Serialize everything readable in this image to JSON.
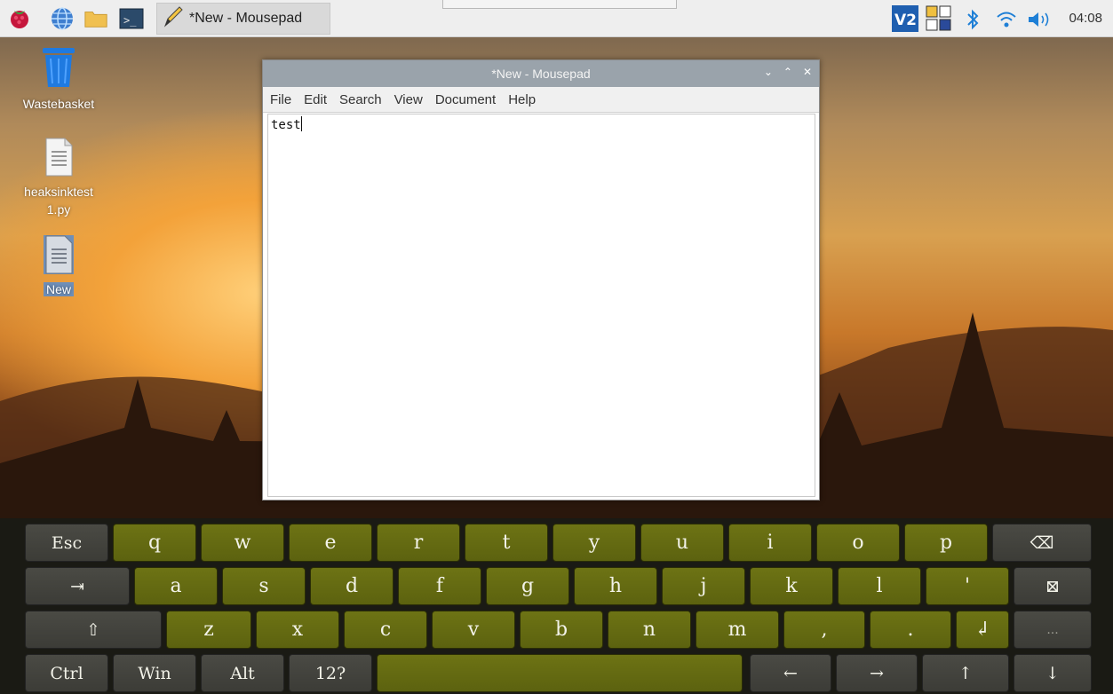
{
  "taskbar": {
    "task_title": "*New - Mousepad",
    "clock": "04:08",
    "icons": [
      "raspberry-menu-icon",
      "browser-globe-icon",
      "file-manager-icon",
      "terminal-icon",
      "text-editor-icon",
      "vnc-icon",
      "keyboard-layout-icon",
      "bluetooth-icon",
      "wifi-icon",
      "volume-icon"
    ]
  },
  "desktop": {
    "items": [
      {
        "label": "Wastebasket",
        "icon": "trash-icon"
      },
      {
        "label": "heaksinktest1.py",
        "icon": "file-icon"
      },
      {
        "label": "New",
        "icon": "file-icon"
      }
    ]
  },
  "window": {
    "title": "*New - Mousepad",
    "menu": [
      "File",
      "Edit",
      "Search",
      "View",
      "Document",
      "Help"
    ],
    "content": "test"
  },
  "keyboard": {
    "row1": [
      "Esc",
      "q",
      "w",
      "e",
      "r",
      "t",
      "y",
      "u",
      "i",
      "o",
      "p",
      "⌫"
    ],
    "row2": [
      "⇥",
      "a",
      "s",
      "d",
      "f",
      "g",
      "h",
      "j",
      "k",
      "l",
      "'",
      "⊠"
    ],
    "row3": [
      "⇧",
      "z",
      "x",
      "c",
      "v",
      "b",
      "n",
      "m",
      ",",
      ".",
      "↲",
      "..."
    ],
    "row4": [
      "Ctrl",
      "Win",
      "Alt",
      "12?",
      "",
      "←",
      "→",
      "↑",
      "↓"
    ]
  },
  "colors": {
    "key_letter": "#62680f",
    "key_modifier": "#40403a",
    "titlebar": "#9aa3ab"
  }
}
